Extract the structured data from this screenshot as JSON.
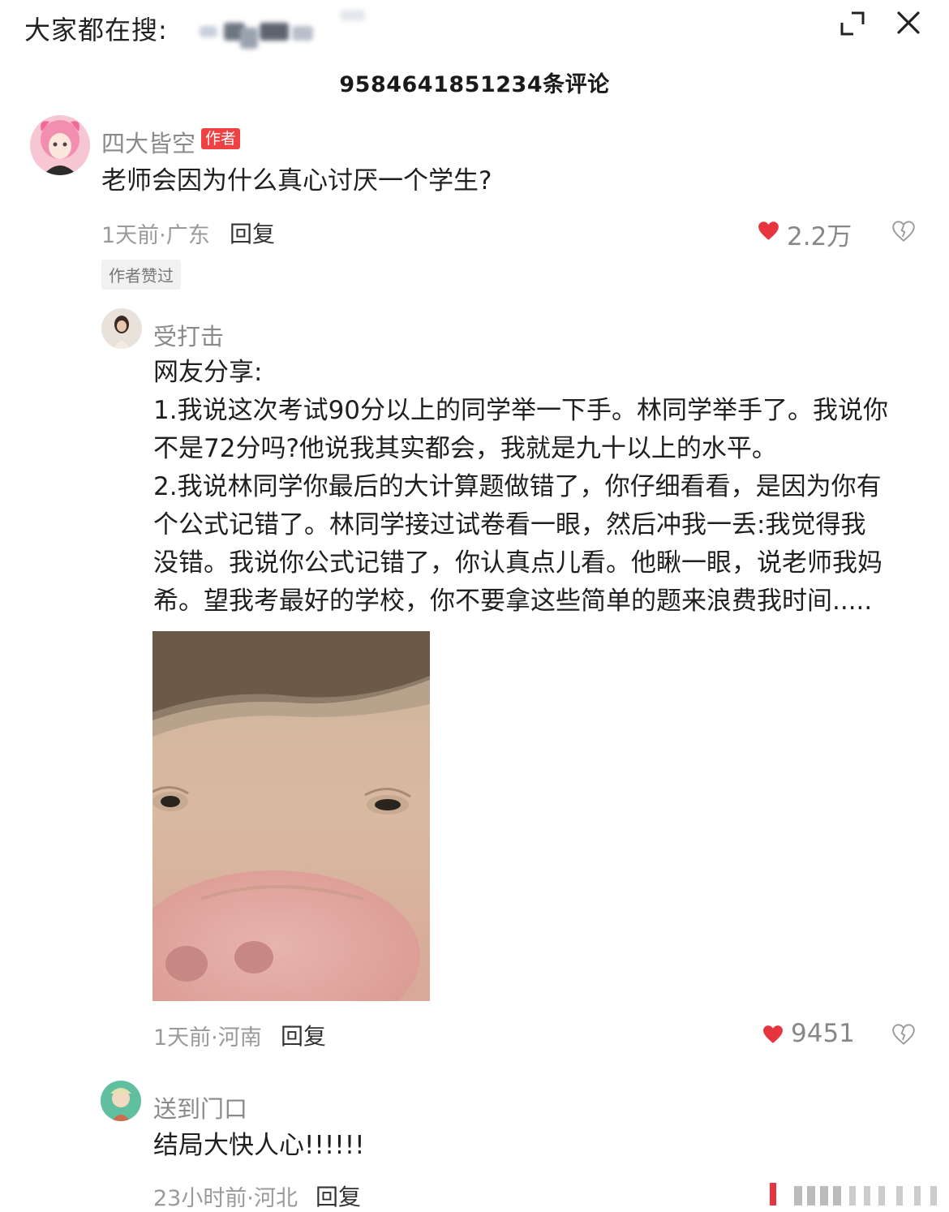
{
  "header": {
    "search_label": "大家都在搜:",
    "comment_count": "9584641851234条评论"
  },
  "colors": {
    "accent_red": "#f04142",
    "heart_red": "#e8343f",
    "text_primary": "#1f1f1f",
    "text_secondary": "#8a8a8a"
  },
  "top_comment": {
    "username": "四大皆空",
    "author_tag": "作者",
    "text": "老师会因为什么真心讨厌一个学生?",
    "meta": "1天前·广东",
    "reply_label": "回复",
    "likes": "2.2万",
    "author_liked": "作者赞过"
  },
  "reply_1": {
    "username": "受打击",
    "lines": [
      "网友分享:",
      "1.我说这次考试90分以上的同学举一下手。林同学举手了。我说你",
      "不是72分吗?他说我其实都会，我就是九十以上的水平。",
      "2.我说林同学你最后的大计算题做错了，你仔细看看，是因为你有",
      "个公式记错了。林同学接过试卷看一眼，然后冲我一丢:我觉得我",
      "没错。我说你公式记错了，你认真点儿看。他瞅一眼，说老师我妈",
      "希。望我考最好的学校，你不要拿这些简单的题来浪费我时间....."
    ],
    "meta": "1天前·河南",
    "reply_label": "回复",
    "likes": "9451"
  },
  "reply_2": {
    "username": "送到门口",
    "text": "结局大快人心!!!!!!",
    "meta": "23小时前·河北",
    "reply_label": "回复"
  }
}
